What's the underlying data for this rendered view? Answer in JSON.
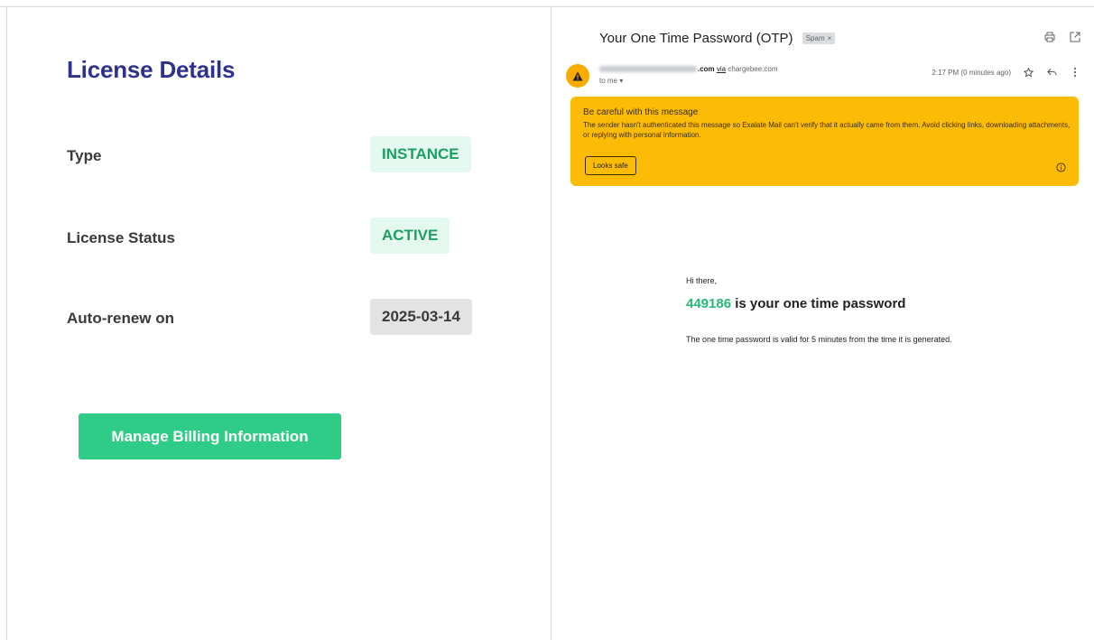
{
  "license": {
    "title": "License Details",
    "rows": [
      {
        "label": "Type",
        "value": "INSTANCE"
      },
      {
        "label": "License Status",
        "value": "ACTIVE"
      },
      {
        "label": "Auto-renew on",
        "value": "2025-03-14"
      }
    ],
    "manage_button": "Manage Billing Information"
  },
  "email": {
    "subject": "Your One Time Password (OTP)",
    "spam_label": "Spam",
    "spam_close": "×",
    "sender_domain": ".com",
    "via_label": "via",
    "via_host": "chargebee.com",
    "to_label": "to me",
    "time": "2:17 PM (0 minutes ago)",
    "warning": {
      "title": "Be careful with this message",
      "body": "The sender hasn't authenticated this message so Exalate Mail can't verify that it actually came from them. Avoid clicking links, downloading attachments, or replying with personal information.",
      "safe_button": "Looks safe"
    },
    "greeting": "Hi there,",
    "otp_code": "449186",
    "otp_text": " is your one time password",
    "validity": "The one time password is valid for 5 minutes from the time it is generated."
  },
  "colors": {
    "title_blue": "#2f3191",
    "pill_green_text": "#1d9f63",
    "pill_green_bg": "#e3f8ee",
    "button_green": "#2ecc87",
    "warning_yellow": "#fcbc05",
    "otp_green": "#27b877"
  }
}
